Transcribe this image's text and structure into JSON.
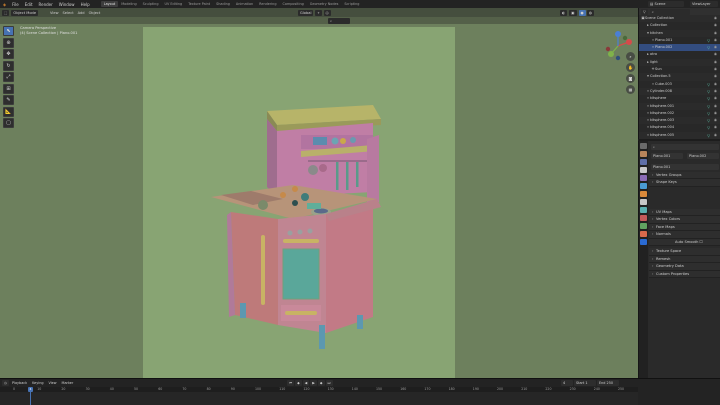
{
  "menus": [
    "File",
    "Edit",
    "Render",
    "Window",
    "Help"
  ],
  "workspaces": [
    {
      "label": "Layout",
      "active": true
    },
    {
      "label": "Modeling",
      "active": false
    },
    {
      "label": "Sculpting",
      "active": false
    },
    {
      "label": "UV Editing",
      "active": false
    },
    {
      "label": "Texture Paint",
      "active": false
    },
    {
      "label": "Shading",
      "active": false
    },
    {
      "label": "Animation",
      "active": false
    },
    {
      "label": "Rendering",
      "active": false
    },
    {
      "label": "Compositing",
      "active": false
    },
    {
      "label": "Geometry Nodes",
      "active": false
    },
    {
      "label": "Scripting",
      "active": false
    }
  ],
  "top_right": {
    "scene": "Scene",
    "view_layer": "ViewLayer"
  },
  "viewport": {
    "mode": "Object Mode",
    "menus": [
      "View",
      "Select",
      "Add",
      "Object"
    ],
    "transform": "Global",
    "info_line1": "Camera Perspective",
    "info_line2": "(4) Scene Collection | Plano.001",
    "tools": [
      "cursor-tool",
      "move-tool",
      "rotate-tool",
      "scale-tool",
      "transform-tool",
      "annotate-tool",
      "measure-tool",
      "add-cube-tool"
    ]
  },
  "outliner": {
    "rows": [
      {
        "indent": 0,
        "icon": "▣",
        "label": "Scene Collection",
        "tri": false,
        "sel": false
      },
      {
        "indent": 1,
        "icon": "▸",
        "label": "Collection",
        "tri": false,
        "sel": false
      },
      {
        "indent": 1,
        "icon": "▾",
        "label": "kitchen",
        "tri": false,
        "sel": false
      },
      {
        "indent": 2,
        "icon": "▿",
        "label": "Plano.001",
        "tri": true,
        "sel": false
      },
      {
        "indent": 2,
        "icon": "▿",
        "label": "Plano.002",
        "tri": true,
        "sel": true
      },
      {
        "indent": 1,
        "icon": "▸",
        "label": "otro",
        "tri": false,
        "sel": false
      },
      {
        "indent": 1,
        "icon": "▸",
        "label": "light",
        "tri": false,
        "sel": false
      },
      {
        "indent": 2,
        "icon": "☀",
        "label": "Sun",
        "tri": false,
        "sel": false
      },
      {
        "indent": 1,
        "icon": "▾",
        "label": "Collection.5",
        "tri": false,
        "sel": false
      },
      {
        "indent": 2,
        "icon": "▿",
        "label": "Cube.003",
        "tri": true,
        "sel": false
      },
      {
        "indent": 1,
        "icon": "▿",
        "label": "Cylinder.008",
        "tri": true,
        "sel": false
      },
      {
        "indent": 1,
        "icon": "▿",
        "label": "kitsphere",
        "tri": true,
        "sel": false
      },
      {
        "indent": 1,
        "icon": "▿",
        "label": "kitsphere.001",
        "tri": true,
        "sel": false
      },
      {
        "indent": 1,
        "icon": "▿",
        "label": "kitsphere.002",
        "tri": true,
        "sel": false
      },
      {
        "indent": 1,
        "icon": "▿",
        "label": "kitsphere.003",
        "tri": true,
        "sel": false
      },
      {
        "indent": 1,
        "icon": "▿",
        "label": "kitsphere.004",
        "tri": true,
        "sel": false
      },
      {
        "indent": 1,
        "icon": "▿",
        "label": "kitsphere.005",
        "tri": true,
        "sel": false
      },
      {
        "indent": 1,
        "icon": "▿",
        "label": "kitsphere.006",
        "tri": true,
        "sel": false
      },
      {
        "indent": 1,
        "icon": "▿",
        "label": "kitsphere.007",
        "tri": true,
        "sel": false
      },
      {
        "indent": 1,
        "icon": "▿",
        "label": "kitsphere.008",
        "tri": true,
        "sel": false
      }
    ]
  },
  "properties": {
    "object_path_a": "Plano.001",
    "object_path_b": "Plano.002",
    "data_name": "Plano.001",
    "panels": [
      "Vertex Groups",
      "Shape Keys",
      "UV Maps",
      "Vertex Colors",
      "Face Maps",
      "Normals"
    ],
    "auto_smooth": "Auto Smooth",
    "panels2": [
      "Texture Space",
      "Remesh",
      "Geometry Data",
      "Custom Properties"
    ],
    "tab_colors": [
      "#6a6a6a",
      "#b9855b",
      "#5f6fa8",
      "#c8c8c8",
      "#8a6bb5",
      "#4a9bd4",
      "#d9893a",
      "#c7c7c7",
      "#5ab0b0",
      "#c35a5a",
      "#61a361",
      "#d96a4c",
      "#2a6bd4"
    ]
  },
  "timeline": {
    "menus": [
      "Playback",
      "Keying",
      "View",
      "Marker"
    ],
    "current_frame": "4",
    "start_label": "Start",
    "start": "1",
    "end_label": "End",
    "end": "250",
    "ticks": [
      "0",
      "10",
      "20",
      "30",
      "40",
      "50",
      "60",
      "70",
      "80",
      "90",
      "100",
      "110",
      "120",
      "130",
      "140",
      "150",
      "160",
      "170",
      "180",
      "190",
      "200",
      "210",
      "220",
      "230",
      "240",
      "250"
    ]
  }
}
